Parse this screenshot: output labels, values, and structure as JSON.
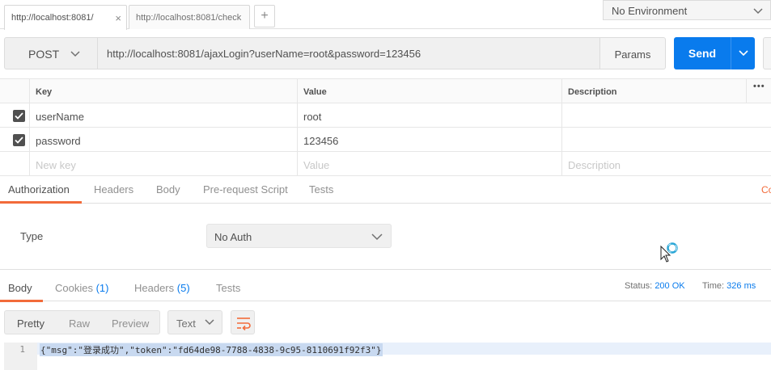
{
  "tabs": [
    {
      "label": "http://localhost:8081/",
      "close": "×"
    },
    {
      "label": "http://localhost:8081/check"
    }
  ],
  "add_tab": "+",
  "environment": {
    "label": "No Environment"
  },
  "request": {
    "method": "POST",
    "url": "http://localhost:8081/ajaxLogin?userName=root&password=123456",
    "params_label": "Params",
    "send_label": "Send"
  },
  "params_table": {
    "headers": {
      "key": "Key",
      "value": "Value",
      "description": "Description",
      "more": "•••"
    },
    "rows": [
      {
        "key": "userName",
        "value": "root",
        "checked": true
      },
      {
        "key": "password",
        "value": "123456",
        "checked": true
      }
    ],
    "new_row": {
      "key": "New key",
      "value": "Value",
      "description": "Description"
    }
  },
  "request_tabs": {
    "items": [
      "Authorization",
      "Headers",
      "Body",
      "Pre-request Script",
      "Tests"
    ],
    "active": "Authorization",
    "cut_label": "Co"
  },
  "auth": {
    "type_label": "Type",
    "type_value": "No Auth"
  },
  "response": {
    "tabs": [
      {
        "label": "Body"
      },
      {
        "label": "Cookies",
        "count": "(1)"
      },
      {
        "label": "Headers",
        "count": "(5)"
      },
      {
        "label": "Tests"
      }
    ],
    "status_label": "Status:",
    "status_value": "200 OK",
    "time_label": "Time:",
    "time_value": "326 ms",
    "view_modes": [
      "Pretty",
      "Raw",
      "Preview"
    ],
    "format": "Text",
    "line_number": "1",
    "body": "{\"msg\":\"登录成功\",\"token\":\"fd64de98-7788-4838-9c95-8110691f92f3\"}"
  },
  "colors": {
    "accent": "#f26b3a",
    "primary": "#097bed"
  }
}
